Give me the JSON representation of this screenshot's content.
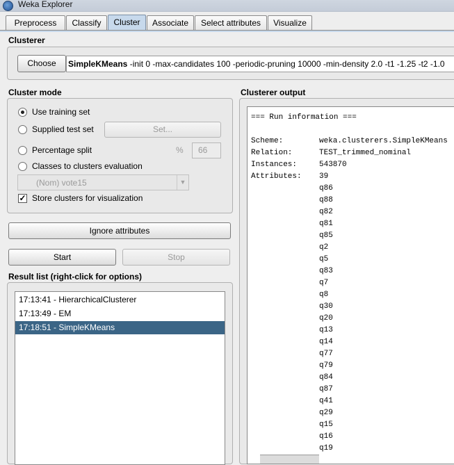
{
  "window": {
    "title": "Weka Explorer"
  },
  "tabs": [
    {
      "label": "Preprocess"
    },
    {
      "label": "Classify"
    },
    {
      "label": "Cluster"
    },
    {
      "label": "Associate"
    },
    {
      "label": "Select attributes"
    },
    {
      "label": "Visualize"
    }
  ],
  "active_tab": "Cluster",
  "clusterer": {
    "section_title": "Clusterer",
    "choose_label": "Choose",
    "algorithm": "SimpleKMeans",
    "options": " -init 0 -max-candidates 100 -periodic-pruning 10000 -min-density 2.0 -t1 -1.25 -t2 -1.0"
  },
  "cluster_mode": {
    "section_title": "Cluster mode",
    "use_training": "Use training set",
    "supplied_test": "Supplied test set",
    "set_label": "Set...",
    "percentage_split": "Percentage split",
    "percent_sign": "%",
    "percent_value": "66",
    "classes_to_clusters": "Classes to clusters evaluation",
    "class_attribute": "(Nom) vote15",
    "store_clusters": "Store clusters for visualization",
    "selected_mode": "Use training set",
    "store_checked": true
  },
  "ignore_attributes_label": "Ignore attributes",
  "start_label": "Start",
  "stop_label": "Stop",
  "result_list": {
    "title": "Result list (right-click for options)",
    "items": [
      {
        "label": "17:13:41 - HierarchicalClusterer"
      },
      {
        "label": "17:13:49 - EM"
      },
      {
        "label": "17:18:51 - SimpleKMeans"
      }
    ],
    "selected_index": 2
  },
  "clusterer_output": {
    "title": "Clusterer output",
    "header": "=== Run information ===",
    "scheme_key": "Scheme:",
    "scheme_value": "weka.clusterers.SimpleKMeans",
    "relation_key": "Relation:",
    "relation_value": "TEST_trimmed_nominal",
    "instances_key": "Instances:",
    "instances_value": "543870",
    "attributes_key": "Attributes:",
    "attributes_value": "39",
    "attribute_list": [
      "q86",
      "q88",
      "q82",
      "q81",
      "q85",
      "q2",
      "q5",
      "q83",
      "q7",
      "q8",
      "q30",
      "q20",
      "q13",
      "q14",
      "q77",
      "q79",
      "q84",
      "q87",
      "q41",
      "q29",
      "q15",
      "q16",
      "q19"
    ]
  },
  "colors": {
    "selection": "#3b6586",
    "active_tab": "#c7d9ec"
  }
}
